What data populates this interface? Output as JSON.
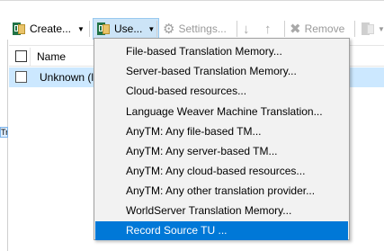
{
  "toolbar": {
    "create_label": "Create...",
    "use_label": "Use...",
    "settings_label": "Settings...",
    "remove_label": "Remove"
  },
  "grid": {
    "column_name": "Name",
    "row_name": "Unknown (la"
  },
  "left_tab_label": "Tr",
  "menu": {
    "items": [
      "File-based Translation Memory...",
      "Server-based Translation Memory...",
      "Cloud-based resources...",
      "Language Weaver Machine Translation...",
      "AnyTM: Any file-based TM...",
      "AnyTM: Any server-based TM...",
      "AnyTM: Any cloud-based resources...",
      "AnyTM: Any other translation provider...",
      "WorldServer Translation Memory...",
      "Record Source TU ..."
    ],
    "selected_index": 9
  },
  "colors": {
    "selection": "#0078d7",
    "row_highlight": "#cce8ff",
    "use_button_bg": "#cce4f7"
  }
}
